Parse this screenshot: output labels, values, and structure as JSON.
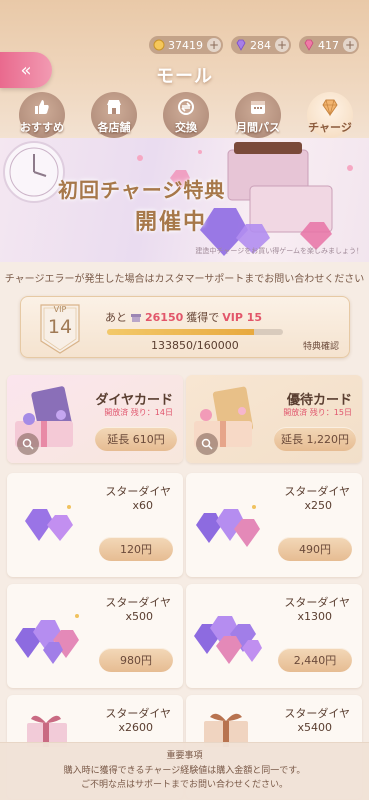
{
  "currency": {
    "gold": {
      "value": "37419",
      "icon": "coin-icon"
    },
    "diamond": {
      "value": "284",
      "icon": "diamond-icon"
    },
    "star_diamond": {
      "value": "417",
      "icon": "star-diamond-icon"
    }
  },
  "header": {
    "title": "モール",
    "back_icon": "double-chevron-left-icon"
  },
  "tabs": [
    {
      "label": "おすすめ",
      "icon": "thumbs-up-icon",
      "active": false
    },
    {
      "label": "各店舗",
      "icon": "store-icon",
      "active": false
    },
    {
      "label": "交換",
      "icon": "exchange-icon",
      "active": false
    },
    {
      "label": "月間パス",
      "icon": "calendar-icon",
      "active": false
    },
    {
      "label": "チャージ",
      "icon": "diamond-icon",
      "active": true
    }
  ],
  "banner": {
    "title_line1": "初回チャージ特典",
    "title_line2": "開催中",
    "note": "建造中チャージをお買い得ゲームを楽しみましょう！"
  },
  "notice": "チャージエラーが発生した場合はカスタマーサポートまでお問い合わせください",
  "vip": {
    "level": "14",
    "label": "VIP",
    "remain_prefix": "あと",
    "remain_value": "26150",
    "remain_mid": "獲得で",
    "next_level": "VIP 15",
    "progress_text": "133850/160000",
    "progress": 0.8366,
    "confirm_label": "特典確認"
  },
  "special_cards": [
    {
      "name": "ダイヤカード",
      "tag": "開放済 残り：14日",
      "price": "延長 610円"
    },
    {
      "name": "優待カード",
      "tag": "開放済 残り：15日",
      "price": "延長 1,220円"
    }
  ],
  "products": [
    {
      "name": "スターダイヤ",
      "qty": "x60",
      "price": "120円"
    },
    {
      "name": "スターダイヤ",
      "qty": "x250",
      "price": "490円"
    },
    {
      "name": "スターダイヤ",
      "qty": "x500",
      "price": "980円"
    },
    {
      "name": "スターダイヤ",
      "qty": "x1300",
      "price": "2,440円"
    },
    {
      "name": "スターダイヤ",
      "qty": "x2600",
      "price": ""
    },
    {
      "name": "スターダイヤ",
      "qty": "x5400",
      "price": ""
    }
  ],
  "footer": {
    "title": "重要事項",
    "line1": "購入時に獲得できるチャージ経験値は購入金額と同一です。",
    "line2": "ご不明な点はサポートまでお問い合わせください。"
  },
  "colors": {
    "accent_pink": "#e96a8e",
    "price_gold": "#e6bc92",
    "vip_red": "#e2566a"
  }
}
